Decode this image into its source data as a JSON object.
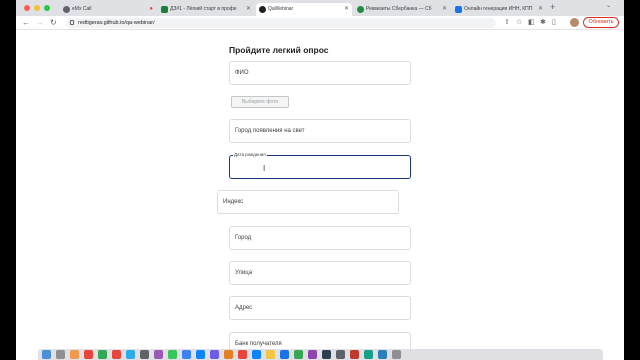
{
  "browser": {
    "tabs": [
      {
        "title": "eMx Call",
        "fav_color": "#5f6368",
        "active": false
      },
      {
        "title": "ДЗ#1 - Лёгкий старт в профе",
        "fav_color": "#188038",
        "active": false
      },
      {
        "title": "QaWebinar",
        "fav_color": "#202124",
        "active": true
      },
      {
        "title": "Реквизиты Сбербанка — Сб",
        "fav_color": "#1e8e3e",
        "active": false
      },
      {
        "title": "Онлайн генерация ИНН, КПП",
        "fav_color": "#1a73e8",
        "active": false
      }
    ],
    "url": "redtigerav.github.io/qa-webinar/",
    "update_label": "Обновить"
  },
  "form": {
    "title": "Пройдите легкий опрос",
    "photo_button_label": "Выберите фото",
    "fields": {
      "fio": "ФИО",
      "birthplace": "Город появления на свет",
      "birthdate_label": "Дата рождения",
      "index": "Индекс",
      "city": "Город",
      "street": "Улица",
      "address": "Адрес",
      "bank_recipient": "Банк получателя"
    }
  },
  "colors": {
    "accent": "#1a3a7a",
    "update": "#d93025"
  }
}
